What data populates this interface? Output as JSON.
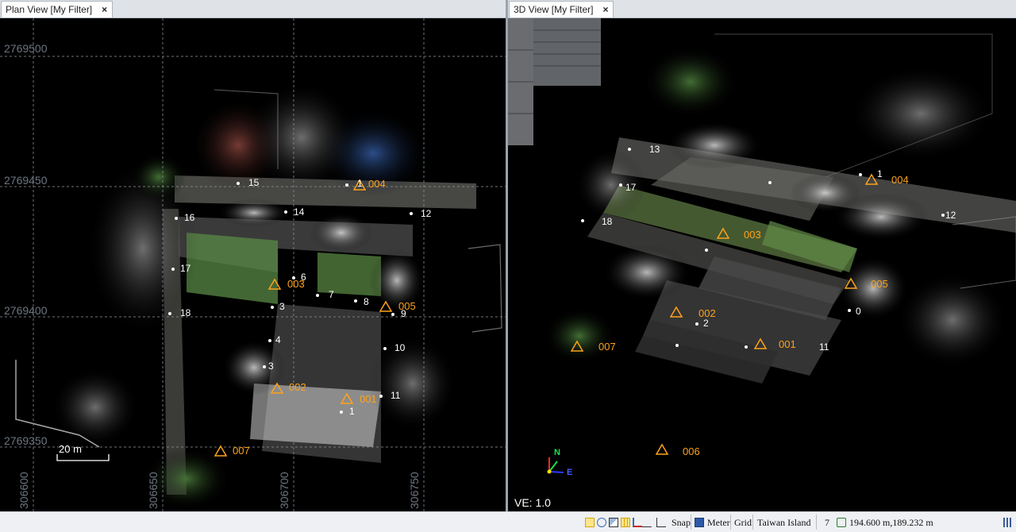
{
  "plan_view": {
    "tab_title": "Plan View [My Filter]",
    "close_glyph": "×",
    "northings": [
      "2769500",
      "2769450",
      "2769400",
      "2769350"
    ],
    "eastings": [
      "306600",
      "306650",
      "306700",
      "306750"
    ],
    "scale_label": "20 m",
    "stations": [
      "004",
      "003",
      "005",
      "002",
      "001",
      "007"
    ],
    "points": [
      "15",
      "1",
      "16",
      "14",
      "12",
      "17",
      "6",
      "7",
      "8",
      "18",
      "9",
      "3",
      "4",
      "10",
      "3",
      "11",
      "1"
    ]
  },
  "view_3d": {
    "tab_title": "3D View [My Filter]",
    "close_glyph": "×",
    "ve_label": "VE: 1.0",
    "axis_n": "N",
    "axis_e": "E",
    "stations": [
      "004",
      "003",
      "005",
      "002",
      "001",
      "007",
      "006"
    ],
    "points": [
      "13",
      "1",
      "17",
      "18",
      "12",
      "0",
      "2",
      "11"
    ]
  },
  "statusbar": {
    "snap": "Snap",
    "units": "Meter",
    "grid": "Grid",
    "coord_system": "Taiwan Island",
    "count": "7",
    "cursor_coords": "194.600 m,189.232 m"
  },
  "colors": {
    "station": "#ffa21a",
    "grid_line": "#8a9099",
    "tab_bg": "#ffffff",
    "statusbar_bg": "#eef0f3"
  }
}
